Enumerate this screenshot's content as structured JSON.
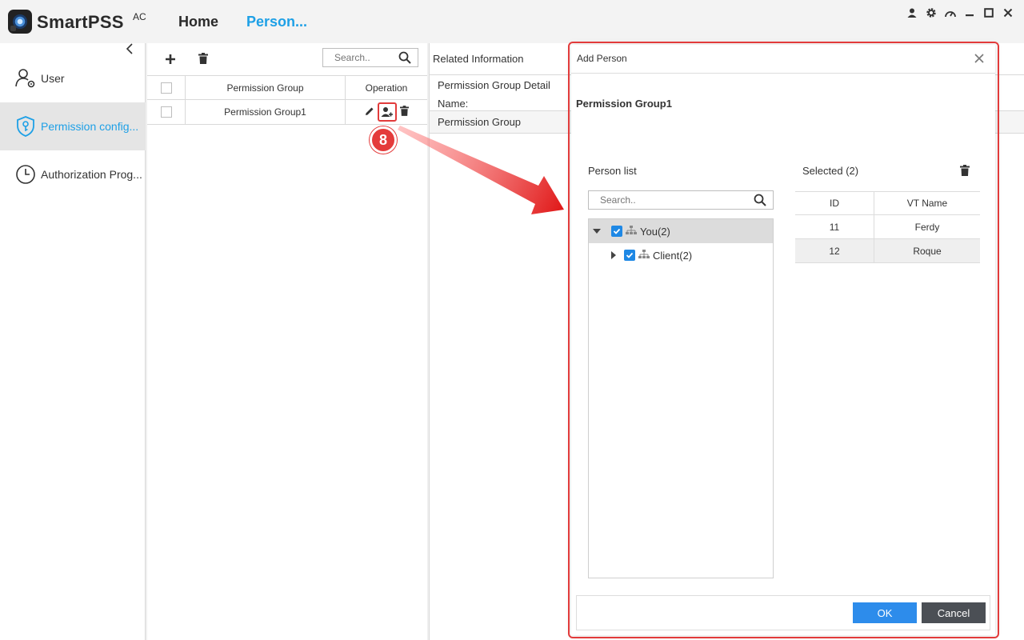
{
  "app": {
    "name": "SmartPSS",
    "superscript": "AC",
    "nav": {
      "home": "Home",
      "person": "Person..."
    },
    "colors": {
      "accent": "#1ea0e6",
      "annotation": "#e23b3b",
      "ok_button": "#2d8ceb",
      "cancel_button": "#4b4f55"
    }
  },
  "window_icons": [
    "user-icon",
    "gear-icon",
    "speedometer-icon",
    "minimize-icon",
    "maximize-icon",
    "close-icon"
  ],
  "sidebar": {
    "items": [
      {
        "label": "User",
        "icon": "user-gear-icon"
      },
      {
        "label": "Permission config...",
        "icon": "shield-key-icon",
        "active": true
      },
      {
        "label": "Authorization Prog...",
        "icon": "clock-icon"
      }
    ]
  },
  "groups_panel": {
    "search_placeholder": "Search..",
    "columns": [
      "Permission Group",
      "Operation"
    ],
    "rows": [
      {
        "name": "Permission Group1"
      }
    ]
  },
  "annotation": {
    "step": "8"
  },
  "related": {
    "title": "Related Information",
    "detail_header": "Permission Group Detail",
    "name_label": "Name:",
    "permission_group_label": "Permission Group"
  },
  "modal": {
    "title": "Add Person",
    "group_name": "Permission Group1",
    "person_list": {
      "title": "Person list",
      "search_placeholder": "Search..",
      "tree": [
        {
          "label": "You(2)",
          "expanded": true,
          "checked": true
        },
        {
          "label": "Client(2)",
          "expanded": false,
          "checked": true
        }
      ]
    },
    "selected": {
      "title": "Selected (2)",
      "columns": [
        "ID",
        "VT Name"
      ],
      "rows": [
        {
          "id": "11",
          "name": "Ferdy"
        },
        {
          "id": "12",
          "name": "Roque"
        }
      ]
    },
    "ok_label": "OK",
    "cancel_label": "Cancel"
  }
}
